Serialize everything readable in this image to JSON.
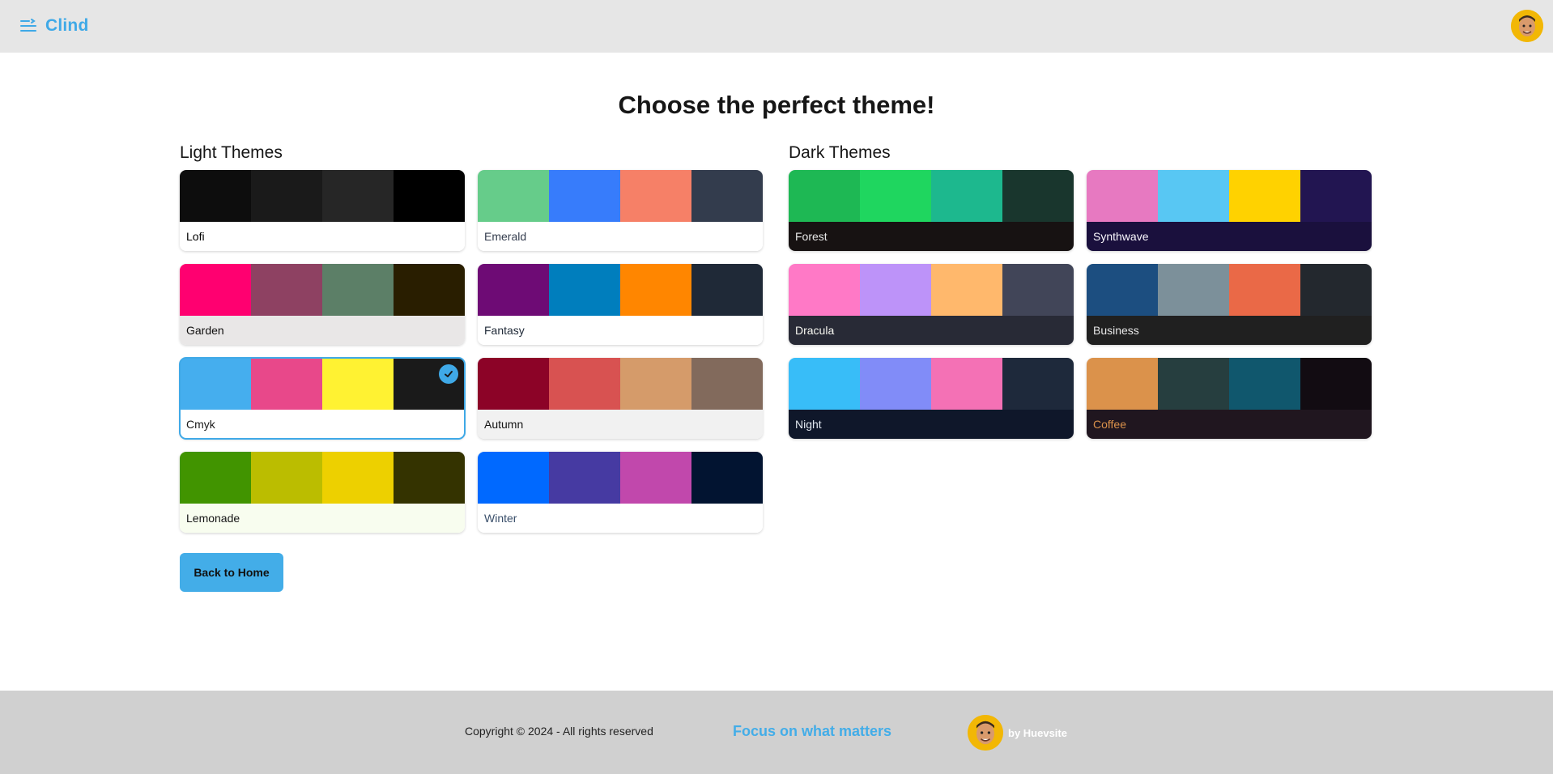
{
  "header": {
    "brand": "Clind",
    "accent": "#3fa9e7",
    "menu_icon": "menu-lines-icon",
    "avatar_icon": "user-avatar"
  },
  "main": {
    "title": "Choose the perfect theme!",
    "light_heading": "Light Themes",
    "dark_heading": "Dark Themes",
    "light_themes": [
      {
        "name": "Lofi",
        "colors": [
          "#0d0d0d",
          "#1a1a1a",
          "#262626",
          "#000000"
        ],
        "bg": "#ffffff",
        "fg": "#000000",
        "selected": false
      },
      {
        "name": "Emerald",
        "colors": [
          "#66cc8a",
          "#377cfb",
          "#f68067",
          "#333c4d"
        ],
        "bg": "#ffffff",
        "fg": "#333c4d",
        "selected": false
      },
      {
        "name": "Garden",
        "colors": [
          "#ff0070",
          "#8e4162",
          "#5c7f67",
          "#291e00"
        ],
        "bg": "#e9e7e7",
        "fg": "#100f0f",
        "selected": false
      },
      {
        "name": "Fantasy",
        "colors": [
          "#6e0b75",
          "#007ebd",
          "#ff8600",
          "#1f2937"
        ],
        "bg": "#ffffff",
        "fg": "#1f2937",
        "selected": false
      },
      {
        "name": "Cmyk",
        "colors": [
          "#45aeee",
          "#e8488a",
          "#fff232",
          "#1a1a1a"
        ],
        "bg": "#ffffff",
        "fg": "#1a1a1a",
        "selected": true
      },
      {
        "name": "Autumn",
        "colors": [
          "#8c0327",
          "#d85251",
          "#d59b6a",
          "#826a5c"
        ],
        "bg": "#f1f1f1",
        "fg": "#141414",
        "selected": false
      },
      {
        "name": "Lemonade",
        "colors": [
          "#419400",
          "#bbbd00",
          "#edd000",
          "#343300"
        ],
        "bg": "#f8fdef",
        "fg": "#151515",
        "selected": false
      },
      {
        "name": "Winter",
        "colors": [
          "#0069ff",
          "#463aa2",
          "#c148ac",
          "#021431"
        ],
        "bg": "#ffffff",
        "fg": "#394e6a",
        "selected": false
      }
    ],
    "dark_themes": [
      {
        "name": "Forest",
        "colors": [
          "#1eb854",
          "#1fd65f",
          "#1db88e",
          "#19362d"
        ],
        "bg": "#171212",
        "fg": "#e8e8e8",
        "selected": false
      },
      {
        "name": "Synthwave",
        "colors": [
          "#e779c1",
          "#58c7f3",
          "#ffd200",
          "#221551"
        ],
        "bg": "#1a103d",
        "fg": "#f9f7fd",
        "selected": false
      },
      {
        "name": "Dracula",
        "colors": [
          "#ff79c6",
          "#bd93f9",
          "#ffb86c",
          "#414558"
        ],
        "bg": "#282a36",
        "fg": "#f8f8f2",
        "selected": false
      },
      {
        "name": "Business",
        "colors": [
          "#1c4e80",
          "#7c909a",
          "#ea6947",
          "#23282e"
        ],
        "bg": "#202020",
        "fg": "#e8e8e8",
        "selected": false
      },
      {
        "name": "Night",
        "colors": [
          "#38bdf8",
          "#818cf8",
          "#f471b5",
          "#1e293b"
        ],
        "bg": "#0f172a",
        "fg": "#e2e8f0",
        "selected": false
      },
      {
        "name": "Coffee",
        "colors": [
          "#db924b",
          "#263e3f",
          "#10576d",
          "#120c12"
        ],
        "bg": "#20161f",
        "fg": "#db924b",
        "selected": false
      }
    ],
    "back_label": "Back to Home"
  },
  "footer": {
    "copyright": "Copyright © 2024 - All rights reserved",
    "tagline": "Focus on what matters",
    "credit": "by Huevsite"
  }
}
